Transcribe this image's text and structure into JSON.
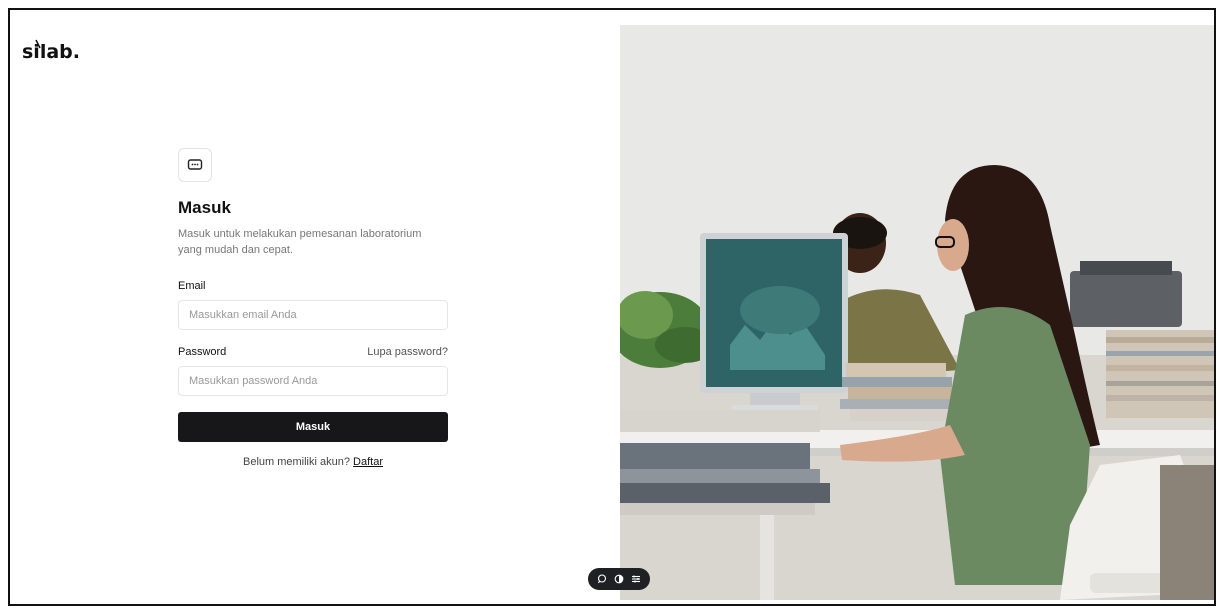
{
  "brand": {
    "logo_text": "silab."
  },
  "login": {
    "title": "Masuk",
    "subtitle": "Masuk untuk melakukan pemesanan laboratorium yang mudah dan cepat.",
    "email_label": "Email",
    "email_placeholder": "Masukkan email Anda",
    "email_value": "",
    "password_label": "Password",
    "forgot_label": "Lupa password?",
    "password_placeholder": "Masukkan password Anda",
    "password_value": "",
    "submit_label": "Masuk",
    "register_prompt": "Belum memiliki akun?",
    "register_link": "Daftar"
  },
  "icons": {
    "badge": "chat-bubble-icon",
    "toolbar": [
      "comment-icon",
      "toggle-icon",
      "settings-icon"
    ]
  },
  "colors": {
    "button_bg": "#17171a",
    "toolbar_bg": "#1e2024",
    "subtitle": "#777777"
  }
}
